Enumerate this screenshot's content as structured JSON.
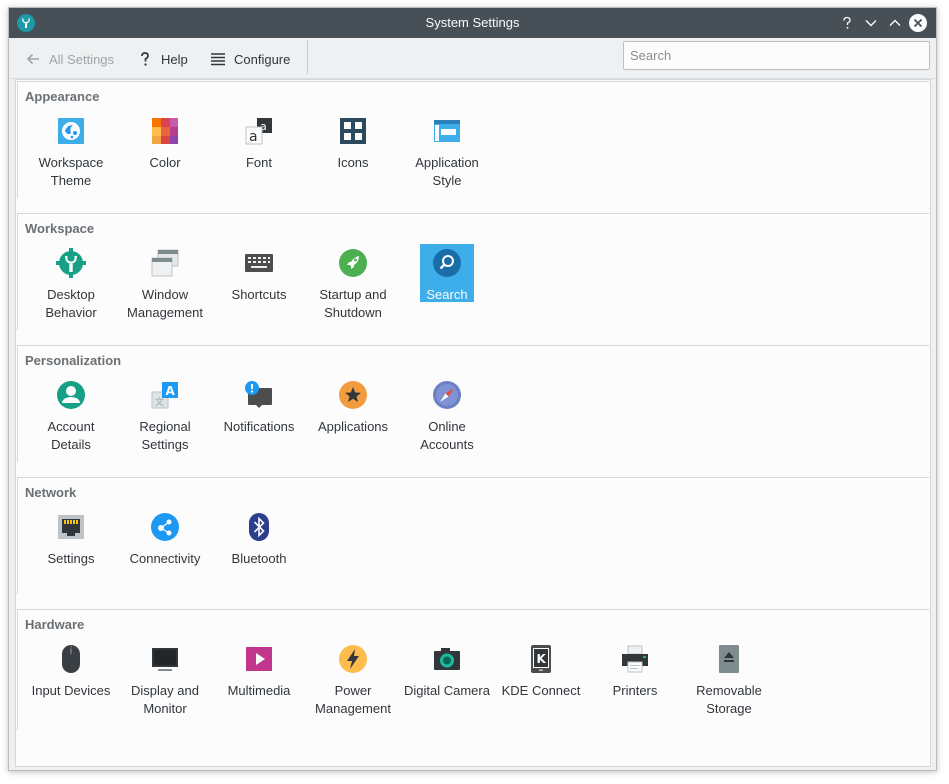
{
  "window": {
    "title": "System Settings"
  },
  "toolbar": {
    "all_settings_label": "All Settings",
    "help_label": "Help",
    "configure_label": "Configure",
    "search_placeholder": "Search"
  },
  "categories": [
    {
      "title": "Appearance",
      "items": [
        {
          "label": "Workspace Theme",
          "icon": "workspace-theme-icon"
        },
        {
          "label": "Color",
          "icon": "color-icon"
        },
        {
          "label": "Font",
          "icon": "font-icon"
        },
        {
          "label": "Icons",
          "icon": "icons-icon"
        },
        {
          "label": "Application Style",
          "icon": "application-style-icon"
        }
      ]
    },
    {
      "title": "Workspace",
      "items": [
        {
          "label": "Desktop Behavior",
          "icon": "desktop-behavior-icon"
        },
        {
          "label": "Window Management",
          "icon": "window-management-icon"
        },
        {
          "label": "Shortcuts",
          "icon": "keyboard-icon"
        },
        {
          "label": "Startup and Shutdown",
          "icon": "rocket-icon"
        },
        {
          "label": "Search",
          "icon": "search-icon",
          "selected": true
        }
      ]
    },
    {
      "title": "Personalization",
      "items": [
        {
          "label": "Account Details",
          "icon": "user-icon"
        },
        {
          "label": "Regional Settings",
          "icon": "regional-icon"
        },
        {
          "label": "Notifications",
          "icon": "notification-icon"
        },
        {
          "label": "Applications",
          "icon": "star-icon"
        },
        {
          "label": "Online Accounts",
          "icon": "compass-icon"
        }
      ]
    },
    {
      "title": "Network",
      "items": [
        {
          "label": "Settings",
          "icon": "ethernet-icon"
        },
        {
          "label": "Connectivity",
          "icon": "connectivity-icon"
        },
        {
          "label": "Bluetooth",
          "icon": "bluetooth-icon"
        }
      ]
    },
    {
      "title": "Hardware",
      "items": [
        {
          "label": "Input Devices",
          "icon": "mouse-icon"
        },
        {
          "label": "Display and Monitor",
          "icon": "monitor-icon"
        },
        {
          "label": "Multimedia",
          "icon": "multimedia-icon"
        },
        {
          "label": "Power Management",
          "icon": "power-icon"
        },
        {
          "label": "Digital Camera",
          "icon": "camera-icon"
        },
        {
          "label": "KDE Connect",
          "icon": "kde-connect-icon"
        },
        {
          "label": "Printers",
          "icon": "printer-icon"
        },
        {
          "label": "Removable Storage",
          "icon": "removable-storage-icon"
        }
      ]
    }
  ],
  "colors": {
    "titlebar": "#475057",
    "selection": "#3daee9",
    "background": "#eff0f1"
  }
}
